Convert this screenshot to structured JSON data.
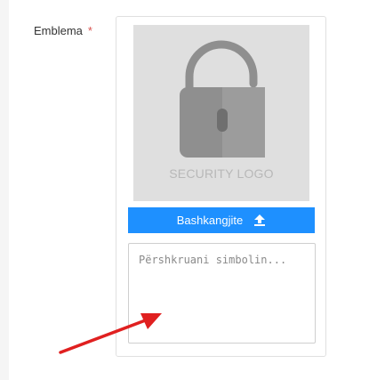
{
  "form": {
    "field_label": "Emblema",
    "required_mark": "*"
  },
  "logo_preview": {
    "icon": "padlock-open-icon",
    "caption": "SECURITY LOGO",
    "background": "#dfdfdf"
  },
  "upload_button": {
    "label": "Bashkangjite",
    "icon": "upload-icon",
    "color": "#1e90ff"
  },
  "description": {
    "value": "",
    "placeholder": "Përshkruani simbolin..."
  },
  "annotation": {
    "icon": "red-arrow-icon",
    "color": "#e02020"
  }
}
